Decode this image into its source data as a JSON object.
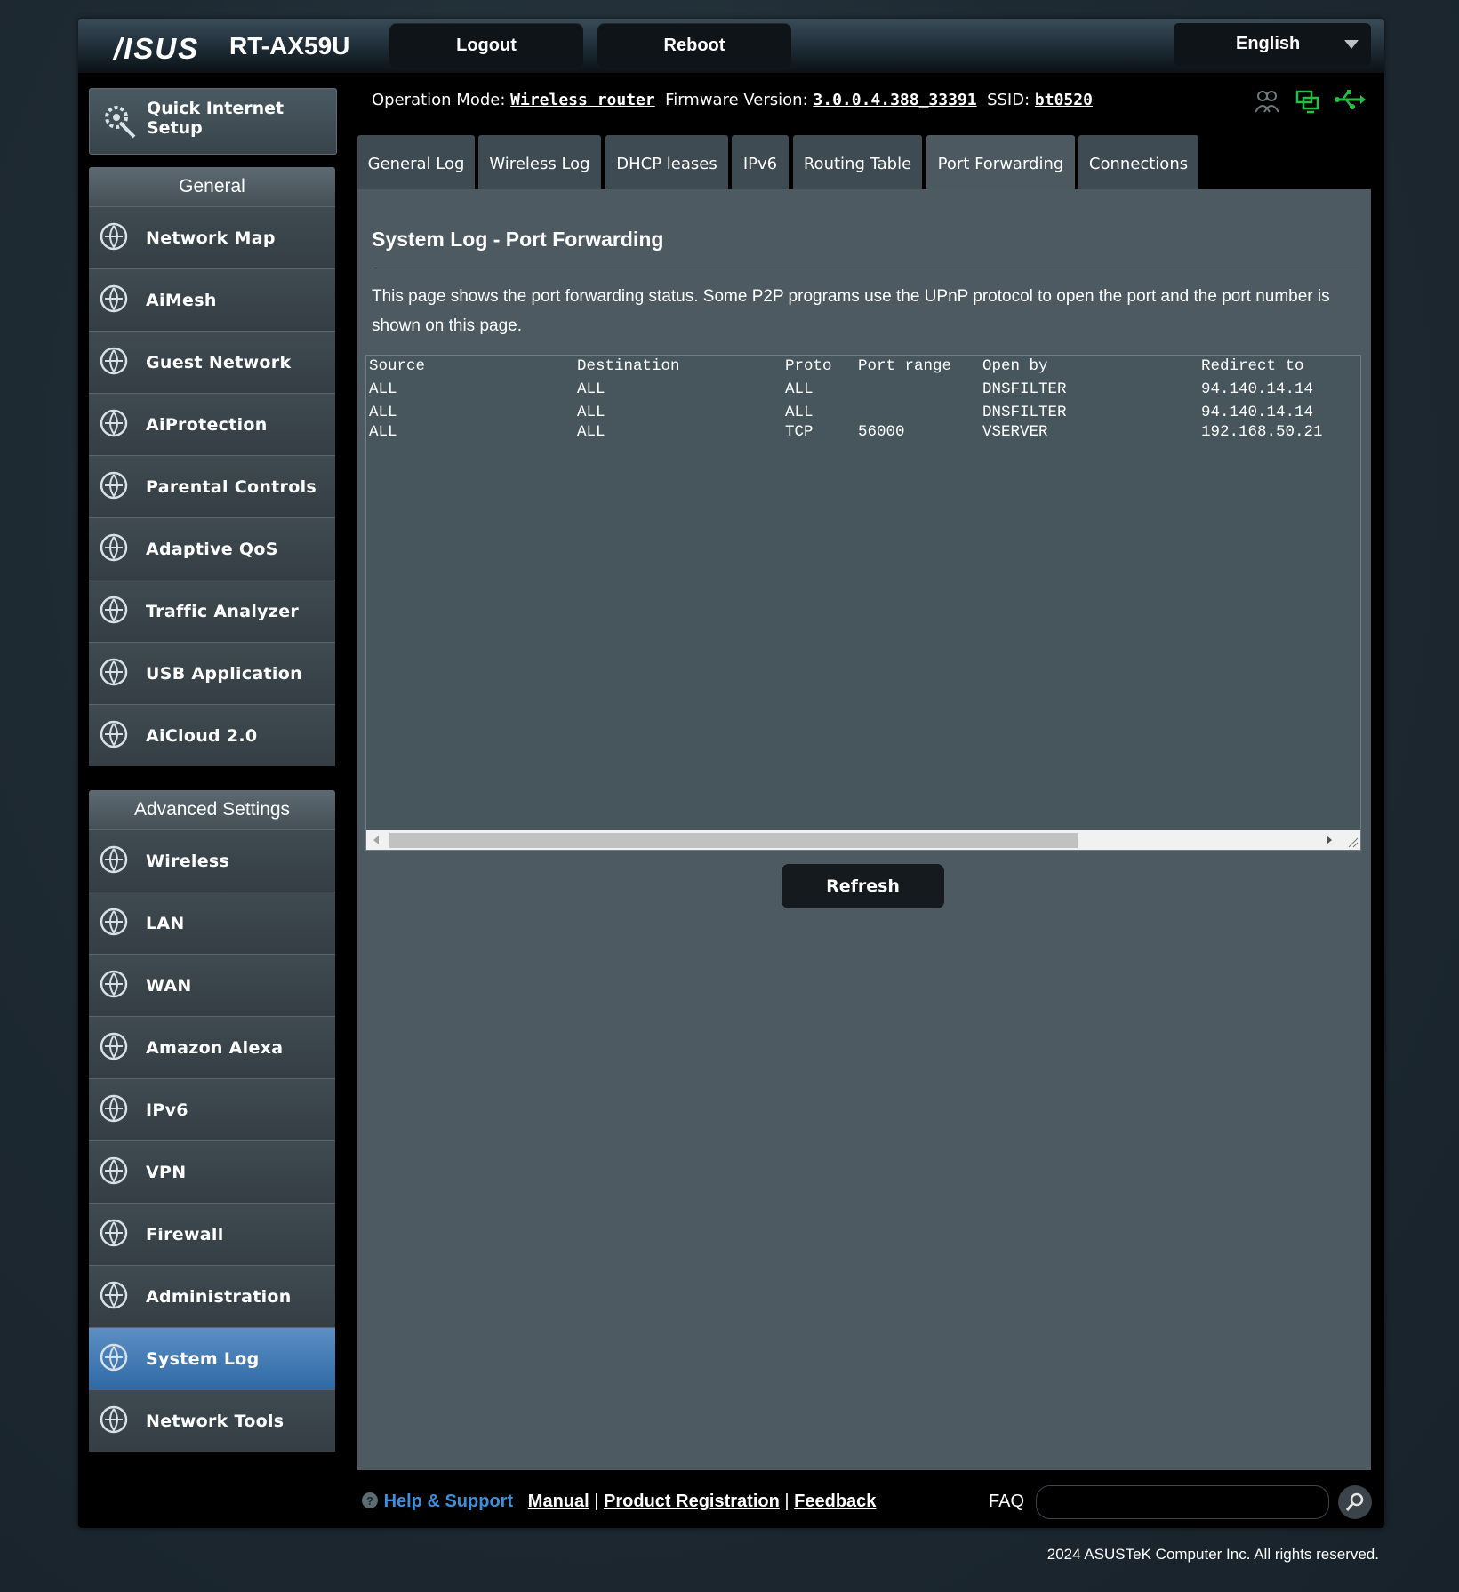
{
  "header": {
    "brand": "/ISUS",
    "model": "RT-AX59U",
    "logout": "Logout",
    "reboot": "Reboot",
    "language": "English"
  },
  "sidebar": {
    "quick_setup": "Quick Internet Setup",
    "general_title": "General",
    "general_items": [
      {
        "label": "Network Map",
        "icon": "network-map-icon"
      },
      {
        "label": "AiMesh",
        "icon": "aimesh-icon"
      },
      {
        "label": "Guest Network",
        "icon": "guest-network-icon"
      },
      {
        "label": "AiProtection",
        "icon": "aiprotection-icon"
      },
      {
        "label": "Parental Controls",
        "icon": "parental-controls-icon"
      },
      {
        "label": "Adaptive QoS",
        "icon": "adaptive-qos-icon"
      },
      {
        "label": "Traffic Analyzer",
        "icon": "traffic-analyzer-icon"
      },
      {
        "label": "USB Application",
        "icon": "usb-application-icon"
      },
      {
        "label": "AiCloud 2.0",
        "icon": "aicloud-icon"
      }
    ],
    "advanced_title": "Advanced Settings",
    "advanced_items": [
      {
        "label": "Wireless",
        "icon": "wireless-icon"
      },
      {
        "label": "LAN",
        "icon": "lan-icon"
      },
      {
        "label": "WAN",
        "icon": "wan-icon"
      },
      {
        "label": "Amazon Alexa",
        "icon": "alexa-icon"
      },
      {
        "label": "IPv6",
        "icon": "ipv6-icon"
      },
      {
        "label": "VPN",
        "icon": "vpn-icon"
      },
      {
        "label": "Firewall",
        "icon": "firewall-icon"
      },
      {
        "label": "Administration",
        "icon": "administration-icon"
      },
      {
        "label": "System Log",
        "icon": "system-log-icon",
        "active": true
      },
      {
        "label": "Network Tools",
        "icon": "network-tools-icon"
      }
    ]
  },
  "status": {
    "operation_mode_label": "Operation Mode:",
    "operation_mode": "Wireless router",
    "firmware_label": "Firmware Version:",
    "firmware": "3.0.0.4.388_33391",
    "ssid_label": "SSID:",
    "ssid": "bt0520"
  },
  "tabs": [
    "General Log",
    "Wireless Log",
    "DHCP leases",
    "IPv6",
    "Routing Table",
    "Port Forwarding",
    "Connections"
  ],
  "active_tab": "Port Forwarding",
  "content": {
    "title": "System Log - Port Forwarding",
    "description": "This page shows the port forwarding status. Some P2P programs use the UPnP protocol to open the port and the port number is shown on this page.",
    "log_columns": [
      "Source",
      "Destination",
      "Proto",
      "Port range",
      "Open by",
      "Redirect to"
    ],
    "log_rows": [
      [
        "ALL",
        "ALL",
        "ALL",
        "",
        "DNSFILTER",
        "94.140.14.14"
      ],
      [
        "ALL",
        "ALL",
        "ALL",
        "",
        "DNSFILTER",
        "94.140.14.14"
      ],
      [
        "ALL",
        "ALL",
        "TCP",
        "56000",
        "VSERVER",
        "192.168.50.21"
      ]
    ],
    "refresh": "Refresh"
  },
  "footer": {
    "help_support": "Help & Support",
    "manual": "Manual",
    "sep": "|",
    "product_registration": "Product Registration",
    "feedback": "Feedback",
    "faq": "FAQ",
    "copyright": "2024 ASUSTeK Computer Inc. All rights reserved."
  },
  "colors": {
    "accent_active": "#3c77b3",
    "help_blue": "#3e8fd9",
    "status_green": "#23c043"
  }
}
